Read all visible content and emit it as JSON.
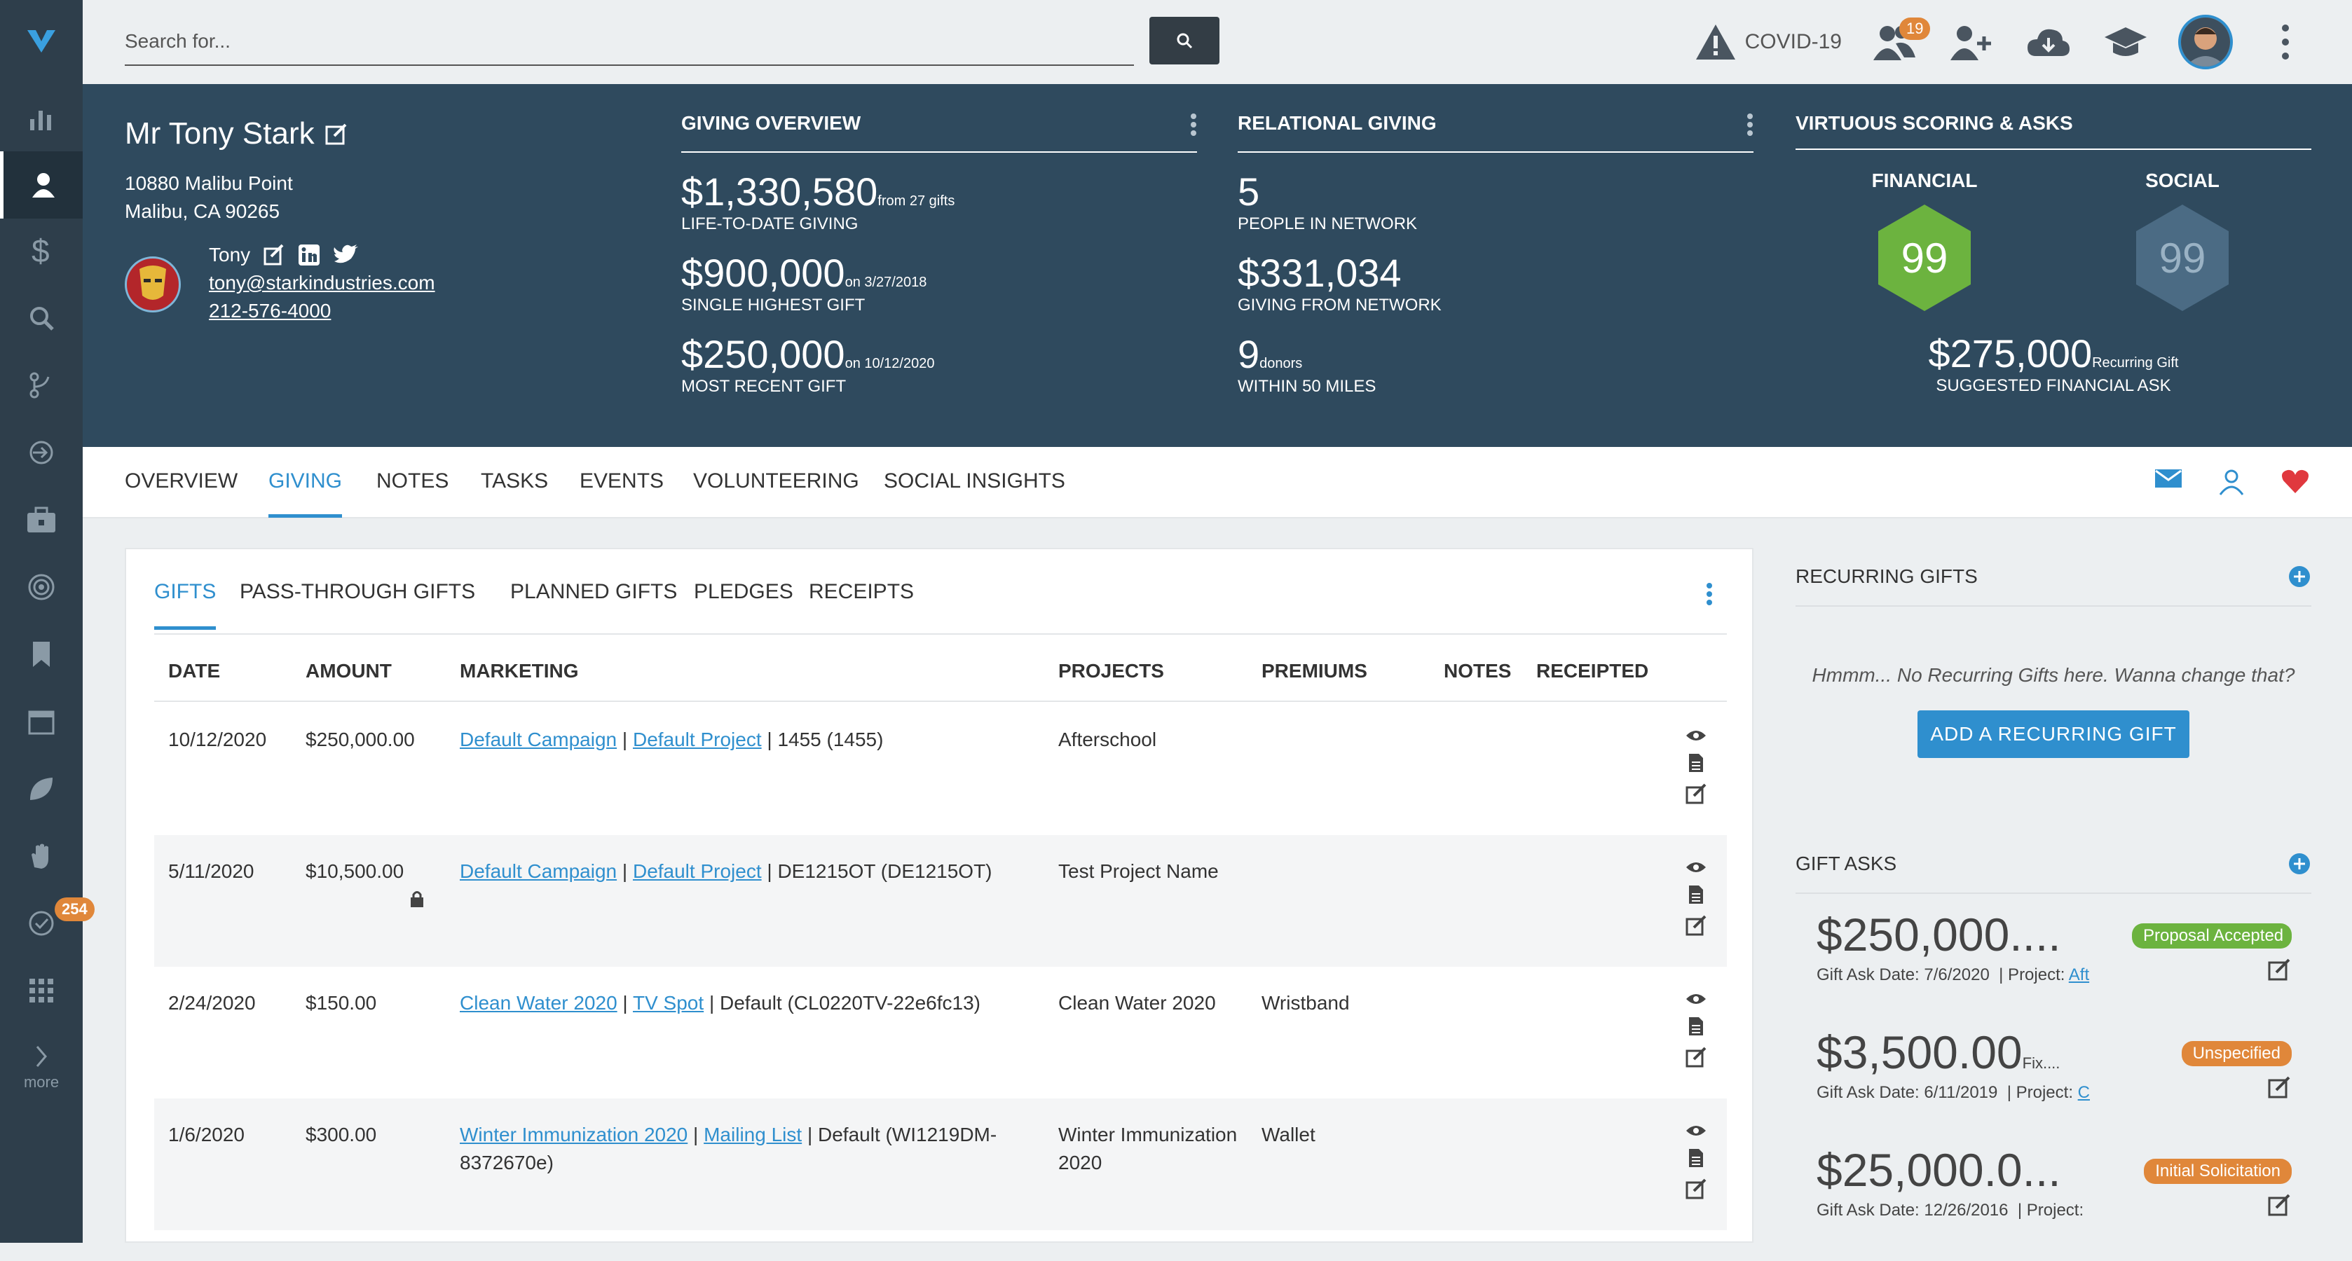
{
  "search": {
    "placeholder": "Search for..."
  },
  "topbar": {
    "covid_label": "COVID-19",
    "notification_count": "19"
  },
  "sidebar": {
    "badge": "254",
    "more_label": "more"
  },
  "profile": {
    "name": "Mr Tony Stark",
    "address_line1": "10880 Malibu Point",
    "address_line2": "Malibu, CA 90265",
    "first_name": "Tony",
    "email": "tony@starkindustries.com",
    "phone": "212-576-4000"
  },
  "giving_overview": {
    "title": "GIVING OVERVIEW",
    "stats": [
      {
        "value": "$1,330,580",
        "suffix": "from 27 gifts",
        "label": "LIFE-TO-DATE GIVING"
      },
      {
        "value": "$900,000",
        "suffix": "on 3/27/2018",
        "label": "SINGLE HIGHEST GIFT"
      },
      {
        "value": "$250,000",
        "suffix": "on 10/12/2020",
        "label": "MOST RECENT GIFT"
      }
    ]
  },
  "relational_giving": {
    "title": "RELATIONAL GIVING",
    "stats": [
      {
        "value": "5",
        "suffix": "",
        "label": "PEOPLE IN NETWORK"
      },
      {
        "value": "$331,034",
        "suffix": "",
        "label": "GIVING FROM NETWORK"
      },
      {
        "value": "9",
        "suffix": "donors",
        "label": "WITHIN 50 MILES"
      }
    ]
  },
  "scoring": {
    "title": "VIRTUOUS SCORING & ASKS",
    "financial_label": "FINANCIAL",
    "financial_score": "99",
    "social_label": "SOCIAL",
    "social_score": "99",
    "ask_value": "$275,000",
    "ask_suffix": "Recurring Gift",
    "ask_label": "SUGGESTED FINANCIAL ASK",
    "colors": {
      "financial": "#6cb33f",
      "social": "#4b6b84"
    }
  },
  "tabs": [
    "OVERVIEW",
    "GIVING",
    "NOTES",
    "TASKS",
    "EVENTS",
    "VOLUNTEERING",
    "SOCIAL INSIGHTS"
  ],
  "subtabs": [
    "GIFTS",
    "PASS-THROUGH GIFTS",
    "PLANNED GIFTS",
    "PLEDGES",
    "RECEIPTS"
  ],
  "table": {
    "headers": [
      "DATE",
      "AMOUNT",
      "MARKETING",
      "PROJECTS",
      "PREMIUMS",
      "NOTES",
      "RECEIPTED"
    ],
    "rows": [
      {
        "date": "10/12/2020",
        "amount": "$250,000.00",
        "campaign": "Default Campaign",
        "project_link": "Default Project",
        "code": "| 1455 (1455)",
        "projects": "Afterschool",
        "premiums": ""
      },
      {
        "date": "5/11/2020",
        "amount": "$10,500.00",
        "campaign": "Default Campaign",
        "project_link": "Default Project",
        "code": "| DE1215OT (DE1215OT)",
        "projects": "Test Project Name",
        "premiums": ""
      },
      {
        "date": "2/24/2020",
        "amount": "$150.00",
        "campaign": "Clean Water 2020",
        "project_link": "TV Spot",
        "code": "| Default (CL0220TV-22e6fc13)",
        "projects": "Clean Water 2020",
        "premiums": "Wristband"
      },
      {
        "date": "1/6/2020",
        "amount": "$300.00",
        "campaign": "Winter Immunization 2020",
        "project_link": "Mailing List",
        "code": "| Default (WI1219DM-8372670e)",
        "projects": "Winter Immunization 2020",
        "premiums": "Wallet"
      }
    ]
  },
  "recurring": {
    "title": "RECURRING GIFTS",
    "empty_text": "Hmmm... No Recurring Gifts here. Wanna change that?",
    "button": "ADD A RECURRING GIFT"
  },
  "gift_asks": {
    "title": "GIFT ASKS",
    "items": [
      {
        "amount": "$250,000....",
        "suffix": "",
        "date_label": "Gift Ask Date: 7/6/2020",
        "project_label": "| Project:",
        "project_link": "Aft",
        "status": "Proposal Accepted",
        "status_color": "#6cb33f"
      },
      {
        "amount": "$3,500.00",
        "suffix": "Fix....",
        "date_label": "Gift Ask Date: 6/11/2019",
        "project_label": "| Project:",
        "project_link": "C",
        "status": "Unspecified",
        "status_color": "#e0873a"
      },
      {
        "amount": "$25,000.0...",
        "suffix": "",
        "date_label": "Gift Ask Date: 12/26/2016",
        "project_label": "| Project:",
        "project_link": "",
        "status": "Initial Solicitation",
        "status_color": "#e0873a"
      }
    ]
  }
}
